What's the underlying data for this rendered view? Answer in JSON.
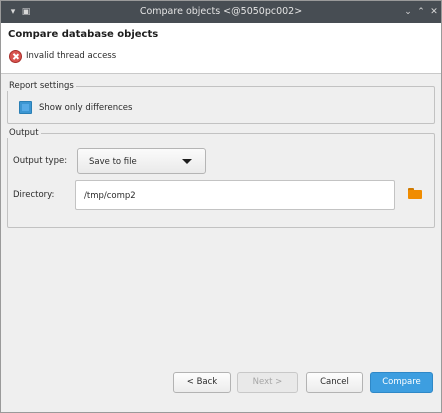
{
  "window": {
    "title": "Compare objects <@5050pc002>"
  },
  "header": {
    "title": "Compare database objects",
    "error_message": "Invalid thread access"
  },
  "report_settings": {
    "legend": "Report settings",
    "show_only_differences_label": "Show only differences",
    "show_only_differences_checked": true
  },
  "output": {
    "legend": "Output",
    "output_type_label": "Output type:",
    "output_type_value": "Save to file",
    "directory_label": "Directory:",
    "directory_value": "/tmp/comp2"
  },
  "buttons": {
    "back": "< Back",
    "next": "Next >",
    "cancel": "Cancel",
    "compare": "Compare"
  },
  "colors": {
    "titlebar": "#474d53",
    "accent": "#3d9ee0",
    "error": "#d9534f",
    "folder": "#f08c00"
  },
  "icons": [
    "window-menu-icon",
    "pin-icon",
    "minimize-icon",
    "maximize-icon",
    "close-icon",
    "error-icon",
    "folder-icon",
    "dropdown-caret-icon"
  ]
}
